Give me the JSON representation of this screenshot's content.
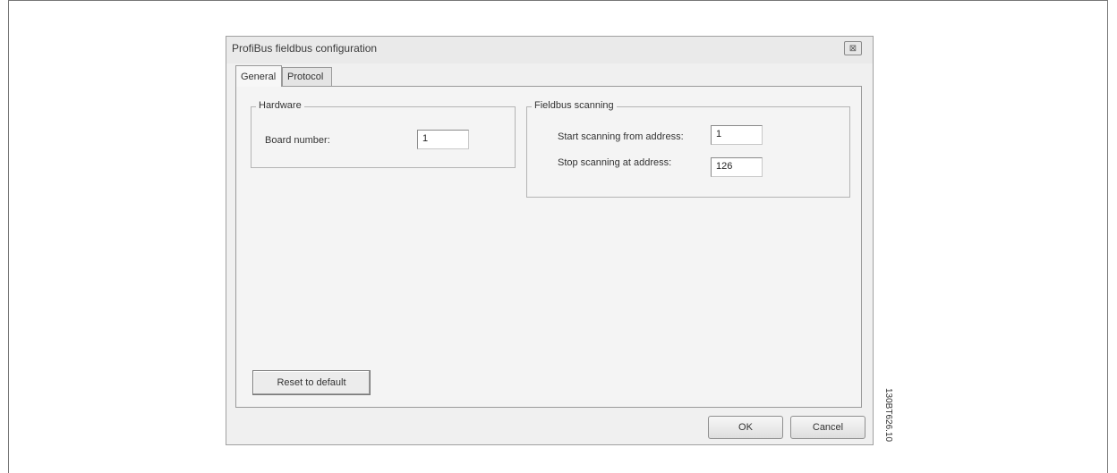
{
  "window": {
    "title": "ProfiBus fieldbus configuration",
    "close_glyph": "⊠"
  },
  "tabs": [
    {
      "label": "General",
      "active": true
    },
    {
      "label": "Protocol",
      "active": false
    }
  ],
  "hardware": {
    "legend": "Hardware",
    "board_number_label": "Board number:",
    "board_number_value": "1"
  },
  "fieldbus_scanning": {
    "legend": "Fieldbus scanning",
    "start_label": "Start scanning from address:",
    "start_value": "1",
    "stop_label": "Stop scanning at address:",
    "stop_value": "126"
  },
  "buttons": {
    "reset": "Reset to default",
    "ok": "OK",
    "cancel": "Cancel"
  },
  "figure_ref": "130BT626.10"
}
